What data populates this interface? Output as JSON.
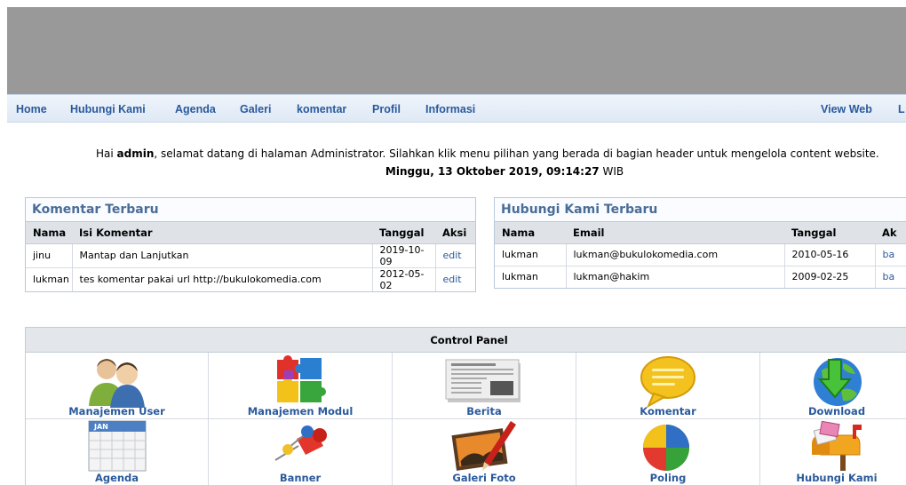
{
  "nav": {
    "items": [
      "Home",
      "Hubungi Kami",
      "Agenda",
      "Galeri",
      "komentar",
      "Profil",
      "Informasi"
    ],
    "view_web": "View Web",
    "logout_partial": "L"
  },
  "welcome": {
    "prefix": "Hai ",
    "user": "admin",
    "suffix": ", selamat datang di halaman Administrator. Silahkan klik menu pilihan yang berada di bagian header untuk mengelola content website.",
    "date": "Minggu, 13 Oktober 2019, 09:14:27",
    "tz": " WIB"
  },
  "komentar": {
    "title": "Komentar Terbaru",
    "headers": [
      "Nama",
      "Isi Komentar",
      "Tanggal",
      "Aksi"
    ],
    "rows": [
      [
        "jinu",
        "Mantap dan Lanjutkan",
        "2019-10-09",
        "edit"
      ],
      [
        "lukman",
        "tes komentar pakai url http://bukulokomedia.com",
        "2012-05-02",
        "edit"
      ]
    ]
  },
  "hubungi": {
    "title": "Hubungi Kami Terbaru",
    "headers": [
      "Nama",
      "Email",
      "Tanggal",
      "Ak"
    ],
    "rows": [
      [
        "lukman",
        "lukman@bukulokomedia.com",
        "2010-05-16",
        "ba"
      ],
      [
        "lukman",
        "lukman@hakim",
        "2009-02-25",
        "ba"
      ]
    ]
  },
  "control_panel": {
    "title": "Control Panel",
    "items": [
      {
        "label": "Manajemen User",
        "icon": "users-icon"
      },
      {
        "label": "Manajemen Modul",
        "icon": "puzzle-icon"
      },
      {
        "label": "Berita",
        "icon": "newspaper-icon"
      },
      {
        "label": "Komentar",
        "icon": "speech-bubble-icon"
      },
      {
        "label": "Download",
        "icon": "download-globe-icon"
      },
      {
        "label": "Agenda",
        "icon": "calendar-icon"
      },
      {
        "label": "Banner",
        "icon": "pushpin-icon"
      },
      {
        "label": "Galeri Foto",
        "icon": "photo-icon"
      },
      {
        "label": "Poling",
        "icon": "pie-chart-icon"
      },
      {
        "label": "Hubungi Kami",
        "icon": "mailbox-icon"
      }
    ],
    "calendar_month": "JAN"
  }
}
